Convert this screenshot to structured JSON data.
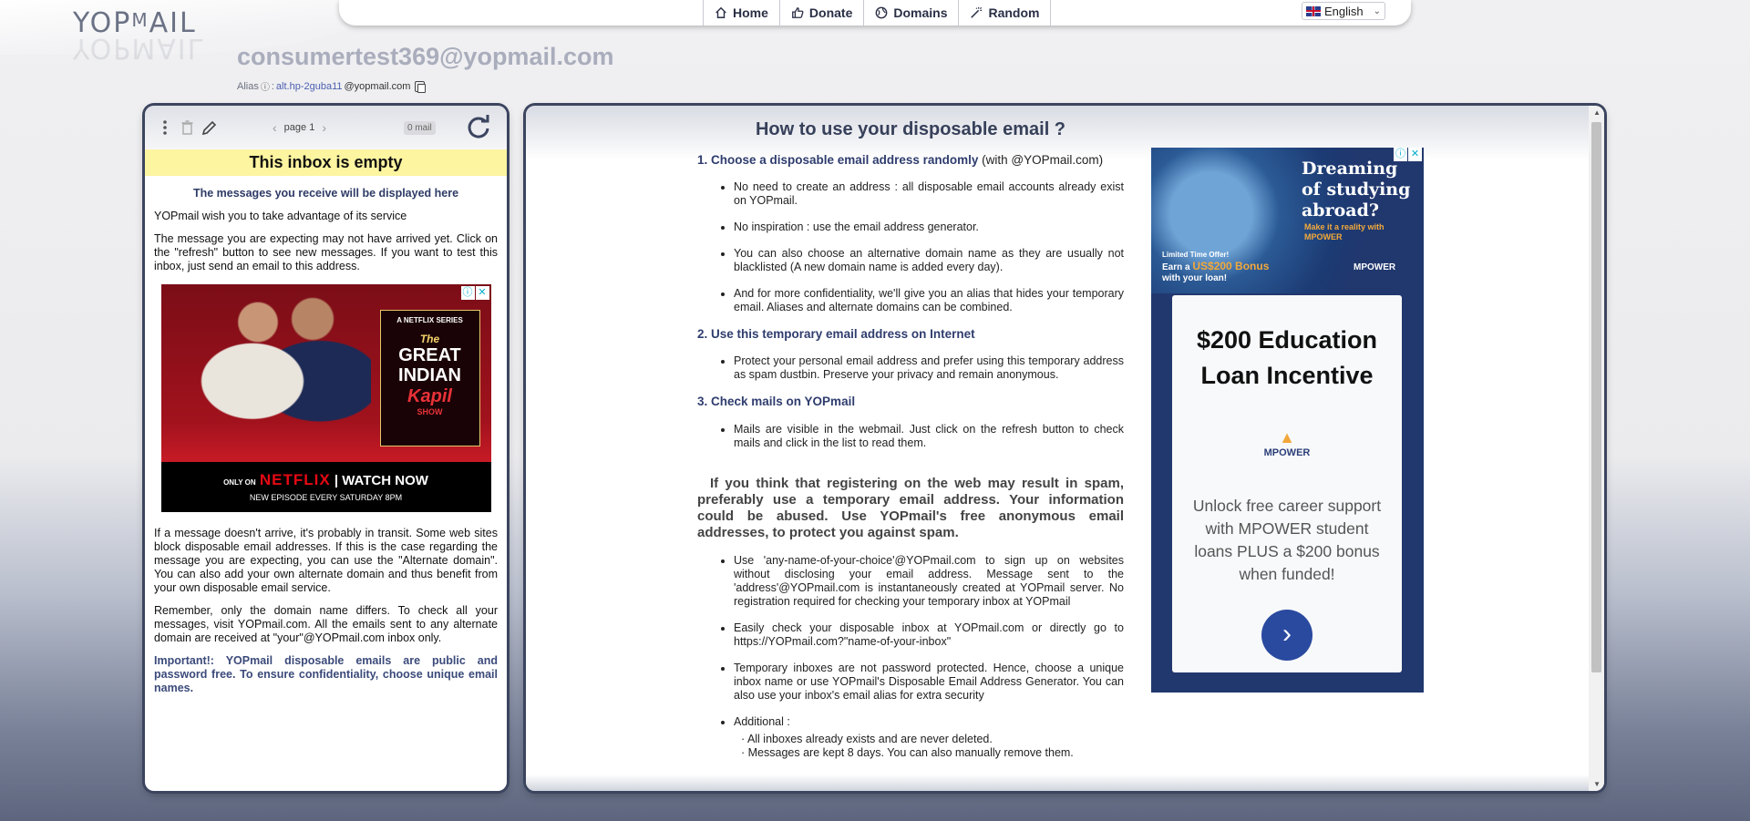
{
  "logo": {
    "text": "YOPMAIL"
  },
  "nav": {
    "items": [
      {
        "label": "Home",
        "icon": "home-icon"
      },
      {
        "label": "Donate",
        "icon": "thumbs-up-icon"
      },
      {
        "label": "Domains",
        "icon": "globe-icon"
      },
      {
        "label": "Random",
        "icon": "magic-wand-icon"
      }
    ],
    "language": "English"
  },
  "inbox": {
    "email": "consumertest369@yopmail.com",
    "alias_label": "Alias",
    "alias_value": "alt.hp-2guba11",
    "alias_domain": "@yopmail.com"
  },
  "left": {
    "page": "page 1",
    "mail_count": "0 mail",
    "empty_banner": "This inbox is empty",
    "subtitle": "The messages you receive will be displayed here",
    "p1": "YOPmail wish you to take advantage of its service",
    "p2": "The message you are expecting may not have arrived yet. Click on the \"refresh\" button to see new messages. If you want to test this inbox, just send an email to this address.",
    "p3": "If a message doesn't arrive, it's probably in transit. Some web sites block disposable email addresses. If this is the case regarding the message you are expecting, you can use the \"Alternate domain\". You can also add your own alternate domain and thus benefit from your own disposable email service.",
    "p4": "Remember, only the domain name differs. To check all your messages, visit YOPmail.com. All the emails sent to any alternate domain are received at \"your\"@YOPmail.com inbox only.",
    "important": "Important!: YOPmail disposable emails are public and password free. To ensure confidentiality, choose unique email names.",
    "ad": {
      "series": "A NETFLIX SERIES",
      "show1": "The",
      "show2": "GREAT INDIAN",
      "show3": "Kapil",
      "show4": "SHOW",
      "only_on": "ONLY ON",
      "netflix": "NETFLIX",
      "watch": "WATCH NOW",
      "episode": "NEW EPISODE EVERY SATURDAY 8PM"
    }
  },
  "help": {
    "title": "How to use your disposable email ?",
    "s1_title": "1. Choose a disposable email address randomly",
    "s1_suffix": "(with @YOPmail.com)",
    "s1_items": [
      "No need to create an address : all disposable email accounts already exist on YOPmail.",
      "No inspiration : use the email address generator.",
      "You can also choose an alternative domain name as they are usually not blacklisted (A new domain name is added every day).",
      "And for more confidentiality, we'll give you an alias that hides your temporary email. Aliases and alternate domains can be combined."
    ],
    "s2_title": "2. Use this temporary email address on Internet",
    "s2_items": [
      "Protect your personal email address and prefer using this temporary address as spam dustbin. Preserve your privacy and remain anonymous."
    ],
    "s3_title": "3. Check mails on YOPmail",
    "s3_items": [
      "Mails are visible in the webmail. Just click on the refresh button to check mails and click in the list to read them."
    ],
    "big_paragraph": "If you think that registering on the web may result in spam, preferably use a temporary email address. Your information could be abused. Use YOPmail's free anonymous email addresses, to protect you against spam.",
    "s4_items": [
      "Use 'any-name-of-your-choice'@YOPmail.com to sign up on websites without disclosing your email address. Message sent to the 'address'@YOPmail.com is instantaneously created at YOPmail server. No registration required for checking your temporary inbox at YOPmail",
      "Easily check your disposable inbox at YOPmail.com or directly go to https://YOPmail.com?\"name-of-your-inbox\"",
      "Temporary inboxes are not password protected. Hence, choose a unique inbox name or use YOPmail's Disposable Email Address Generator. You can also use your inbox's email alias for extra security",
      "Additional :"
    ],
    "additional": [
      "· All inboxes already exists and are never deleted.",
      "· Messages are kept 8 days. You can also manually remove them."
    ]
  },
  "ad_right": {
    "headline": "Dreaming of studying abroad?",
    "make": "Make it a reality with MPOWER",
    "offer1": "Limited Time Offer!",
    "offer2": "Earn a",
    "offer_amount": "US$200 Bonus",
    "offer3": "with your loan!",
    "logo": "MPOWER",
    "card_title": "$200 Education Loan Incentive",
    "card_logo": "MPOWER",
    "card_body": "Unlock free career support with MPOWER student loans PLUS a $200 bonus when funded!"
  }
}
